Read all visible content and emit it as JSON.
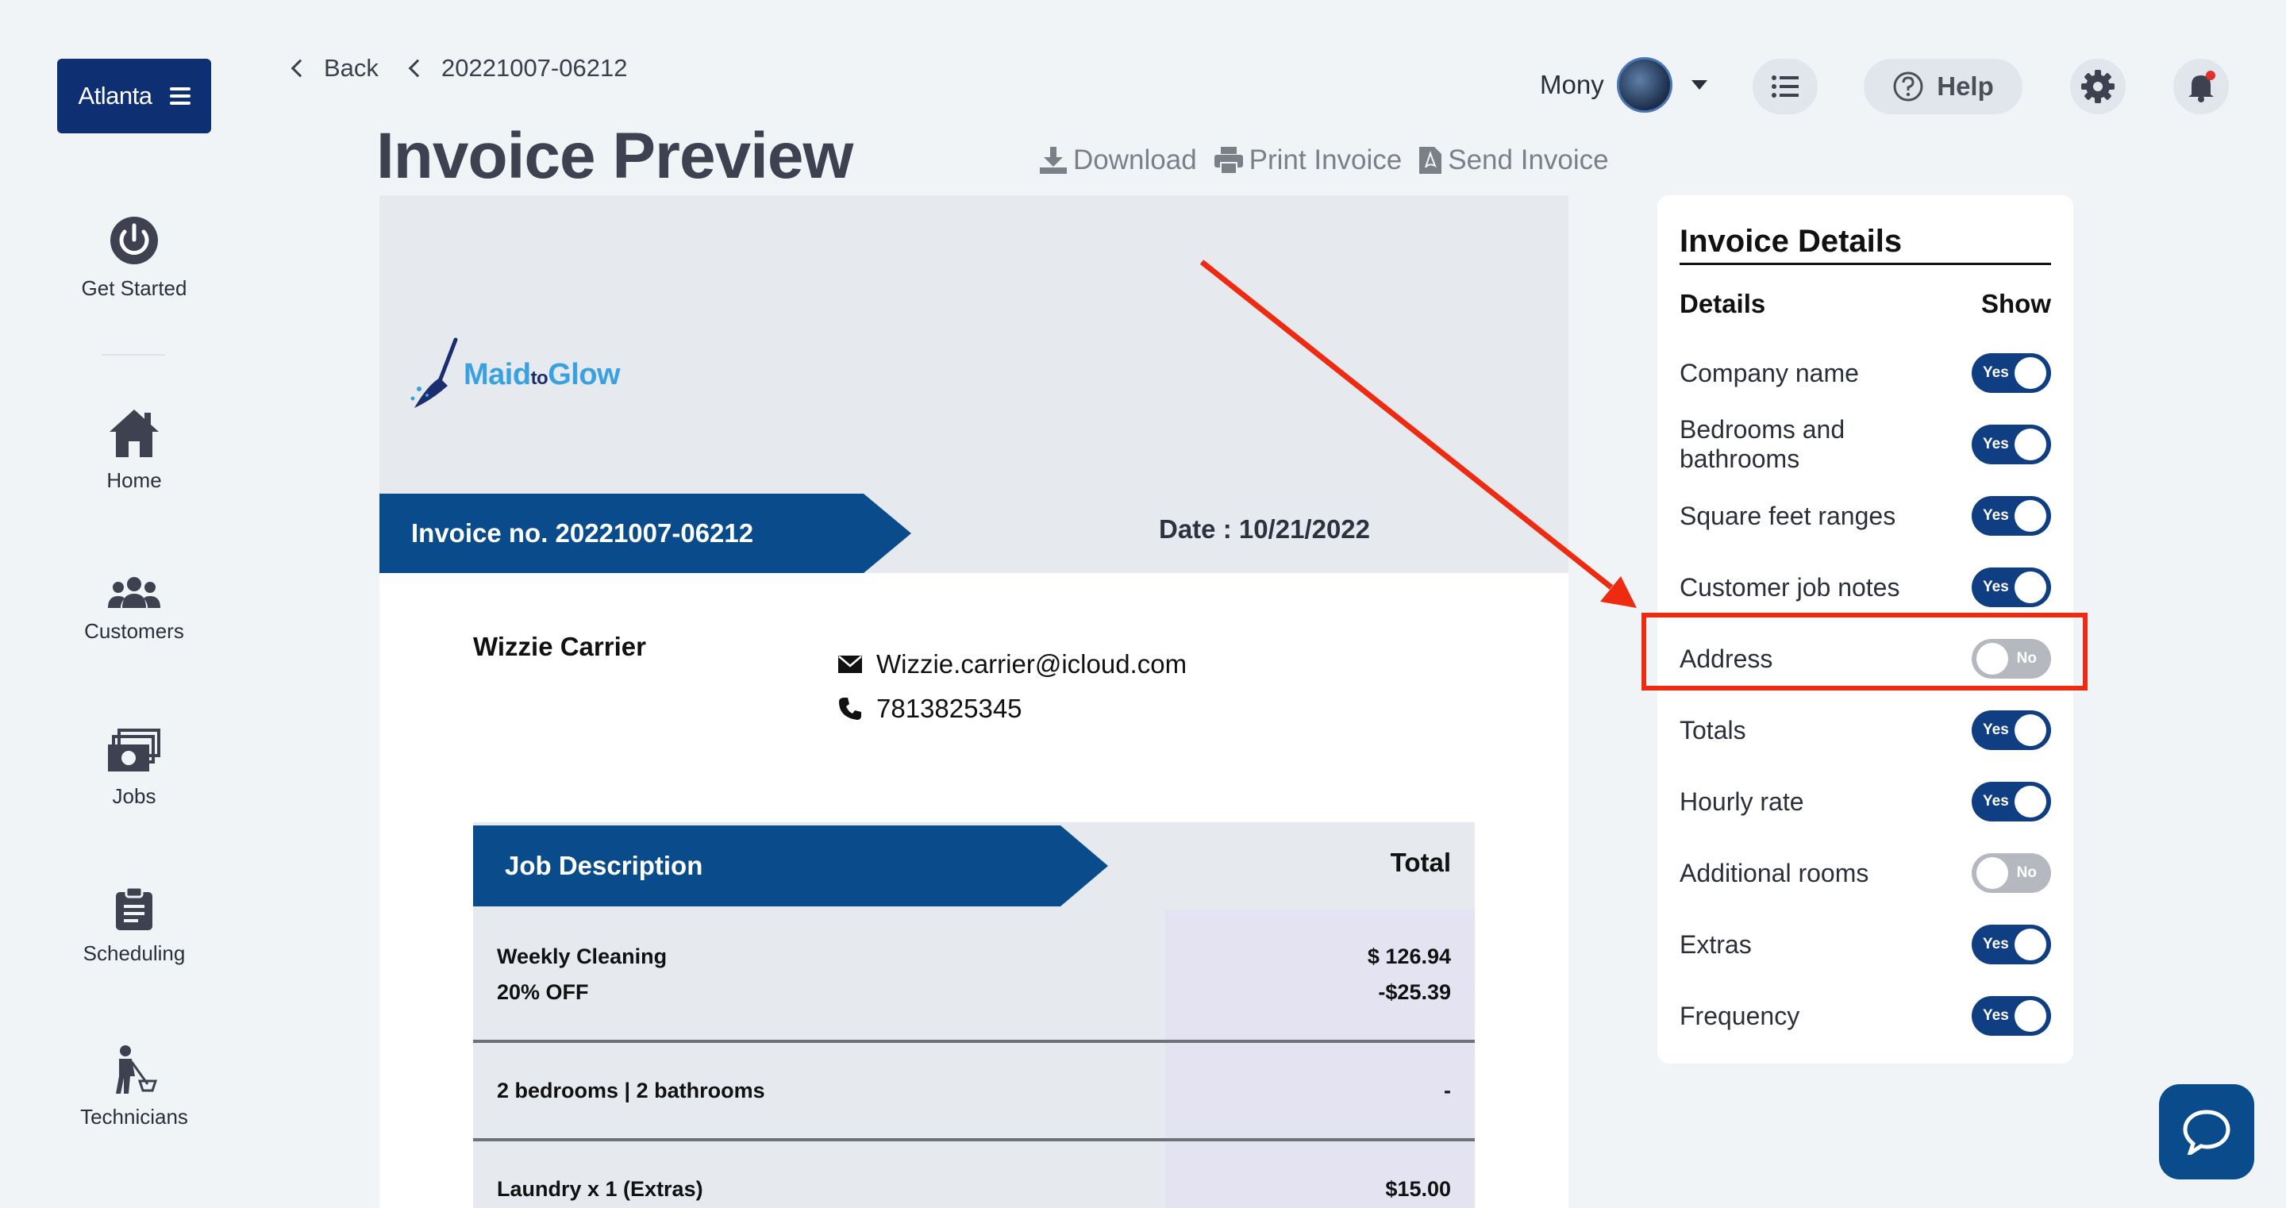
{
  "sidebar": {
    "brand": "Atlanta",
    "items": [
      {
        "label": "Get Started",
        "icon": "power-icon"
      },
      {
        "label": "Home",
        "icon": "home-icon"
      },
      {
        "label": "Customers",
        "icon": "users-icon"
      },
      {
        "label": "Jobs",
        "icon": "cash-icon"
      },
      {
        "label": "Scheduling",
        "icon": "clipboard-icon"
      },
      {
        "label": "Technicians",
        "icon": "cleaner-icon"
      }
    ]
  },
  "breadcrumb": {
    "back": "Back",
    "current": "20221007-06212"
  },
  "page": {
    "title": "Invoice Preview"
  },
  "actions": {
    "download": "Download",
    "print": "Print Invoice",
    "send": "Send Invoice"
  },
  "header": {
    "user_name": "Mony",
    "help_label": "Help"
  },
  "invoice": {
    "logo_parts": [
      "Maid",
      "to",
      "Glow"
    ],
    "invoice_no": "Invoice no. 20221007-06212",
    "date": "Date : 10/21/2022",
    "customer_name": "Wizzie Carrier",
    "email": "Wizzie.carrier@icloud.com",
    "phone": "7813825345",
    "table": {
      "col_description": "Job Description",
      "col_total": "Total",
      "rows": [
        {
          "desc": [
            "Weekly Cleaning",
            "20% OFF"
          ],
          "amount": [
            "$ 126.94",
            "-$25.39"
          ]
        },
        {
          "desc": [
            "2 bedrooms | 2 bathrooms"
          ],
          "amount": [
            "-"
          ]
        },
        {
          "desc": [
            "Laundry x 1 (Extras)"
          ],
          "amount": [
            "$15.00"
          ]
        }
      ]
    }
  },
  "details_panel": {
    "title": "Invoice Details",
    "col_details": "Details",
    "col_show": "Show",
    "yes_label": "Yes",
    "no_label": "No",
    "rows": [
      {
        "label": "Company name",
        "on": true
      },
      {
        "label": "Bedrooms and bathrooms",
        "on": true
      },
      {
        "label": "Square feet ranges",
        "on": true
      },
      {
        "label": "Customer job notes",
        "on": true
      },
      {
        "label": "Address",
        "on": false
      },
      {
        "label": "Totals",
        "on": true
      },
      {
        "label": "Hourly rate",
        "on": true
      },
      {
        "label": "Additional rooms",
        "on": false
      },
      {
        "label": "Extras",
        "on": true
      },
      {
        "label": "Frequency",
        "on": true
      }
    ]
  },
  "colors": {
    "brand_navy": "#0f2f73",
    "band_blue": "#0a4c8b",
    "annotation_red": "#ee2a10"
  }
}
